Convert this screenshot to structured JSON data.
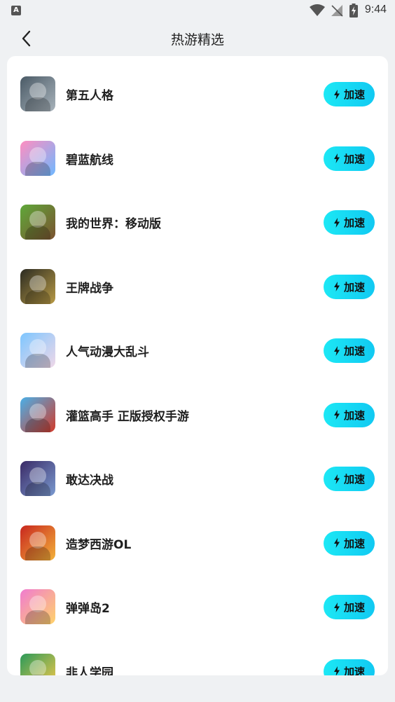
{
  "status_bar": {
    "time": "9:44",
    "app_icon_letter": "A"
  },
  "header": {
    "title": "热游精选"
  },
  "games": [
    {
      "name": "第五人格",
      "button": "加速",
      "icon": "identity-v-game-icon",
      "colors": [
        "#4a5a66",
        "#a8b3bb"
      ]
    },
    {
      "name": "碧蓝航线",
      "button": "加速",
      "icon": "azur-lane-game-icon",
      "colors": [
        "#ff8ec0",
        "#6fb8ff"
      ]
    },
    {
      "name": "我的世界：移动版",
      "button": "加速",
      "icon": "minecraft-game-icon",
      "colors": [
        "#5fa83a",
        "#7b5230"
      ]
    },
    {
      "name": "王牌战争",
      "button": "加速",
      "icon": "war-game-icon",
      "colors": [
        "#2b2b22",
        "#b89a45"
      ]
    },
    {
      "name": "人气动漫大乱斗",
      "button": "加速",
      "icon": "anime-fight-game-icon",
      "colors": [
        "#7dc6ff",
        "#f0d8e8"
      ]
    },
    {
      "name": "灌篮高手 正版授权手游",
      "button": "加速",
      "icon": "slam-dunk-game-icon",
      "colors": [
        "#4ab0e8",
        "#d23a2a"
      ]
    },
    {
      "name": "敢达决战",
      "button": "加速",
      "icon": "gundam-game-icon",
      "colors": [
        "#3a2a66",
        "#7a9ad0"
      ]
    },
    {
      "name": "造梦西游OL",
      "button": "加速",
      "icon": "dream-journey-game-icon",
      "colors": [
        "#c8261e",
        "#f3b23a"
      ]
    },
    {
      "name": "弹弹岛2",
      "button": "加速",
      "icon": "ddtank-game-icon",
      "colors": [
        "#f07bd0",
        "#ffd36a"
      ]
    },
    {
      "name": "非人学园",
      "button": "加速",
      "icon": "inhuman-academy-game-icon",
      "colors": [
        "#2c9a5a",
        "#f6c94a"
      ]
    }
  ]
}
